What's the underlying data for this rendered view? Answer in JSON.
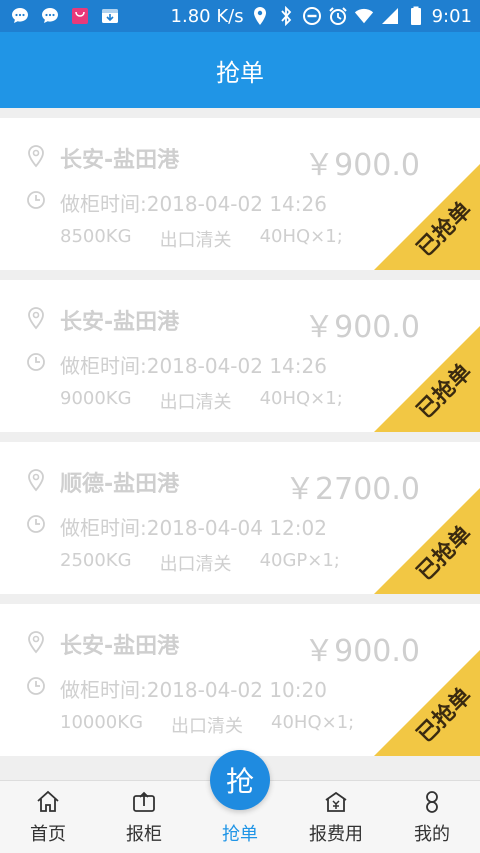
{
  "status_bar": {
    "speed": "1.80 K/s",
    "time": "9:01",
    "icons": [
      "chat-icon",
      "chat-icon",
      "shopping-bag-icon",
      "download-icon",
      "location-icon",
      "bluetooth-icon",
      "dnd-icon",
      "alarm-icon",
      "wifi-icon",
      "signal-icon",
      "battery-icon"
    ]
  },
  "header": {
    "title": "抢单"
  },
  "orders": [
    {
      "route": "长安-盐田港",
      "price": "￥900.0",
      "time": "做柜时间:2018-04-02 14:26",
      "weight": "8500KG",
      "type": "出口清关",
      "container": "40HQ×1;",
      "badge": "已抢单"
    },
    {
      "route": "长安-盐田港",
      "price": "￥900.0",
      "time": "做柜时间:2018-04-02 14:26",
      "weight": "9000KG",
      "type": "出口清关",
      "container": "40HQ×1;",
      "badge": "已抢单"
    },
    {
      "route": "顺德-盐田港",
      "price": "￥2700.0",
      "time": "做柜时间:2018-04-04 12:02",
      "weight": "2500KG",
      "type": "出口清关",
      "container": "40GP×1;",
      "badge": "已抢单"
    },
    {
      "route": "长安-盐田港",
      "price": "￥900.0",
      "time": "做柜时间:2018-04-02 10:20",
      "weight": "10000KG",
      "type": "出口清关",
      "container": "40HQ×1;",
      "badge": "已抢单"
    }
  ],
  "tabbar": {
    "items": [
      {
        "label": "首页",
        "icon": "home-icon"
      },
      {
        "label": "报柜",
        "icon": "upload-box-icon"
      },
      {
        "label": "抢单",
        "icon": "grab-order-icon"
      },
      {
        "label": "报费用",
        "icon": "fee-icon"
      },
      {
        "label": "我的",
        "icon": "user-icon"
      }
    ],
    "active_index": 2,
    "center_glyph": "抢"
  },
  "colors": {
    "primary": "#2095e6",
    "ribbon": "#f2c744",
    "muted_text": "#cfcfcf"
  }
}
